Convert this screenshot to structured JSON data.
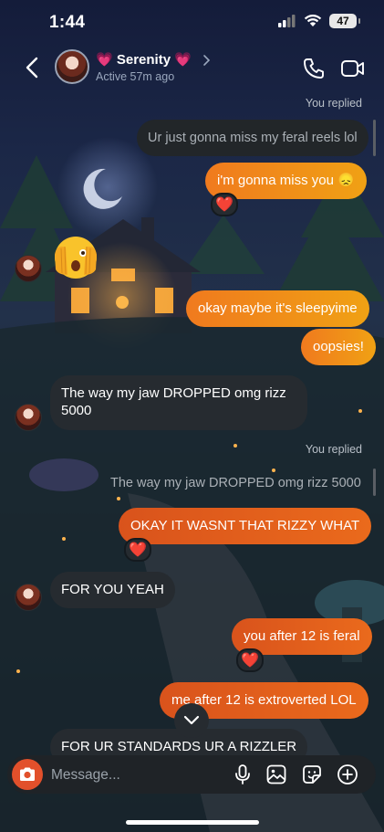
{
  "status_bar": {
    "time": "1:44",
    "battery": "47"
  },
  "header": {
    "contact_name": "💗 Serenity 💗",
    "status": "Active 57m ago",
    "icons": [
      "back-arrow-icon",
      "chevron-right-icon",
      "phone-icon",
      "video-camera-icon"
    ]
  },
  "messages": [
    {
      "type": "reply_label",
      "text": "You replied"
    },
    {
      "type": "quoted",
      "text": "Ur just gonna miss my feral reels lol"
    },
    {
      "type": "outgoing",
      "text": "i'm gonna miss you 😞",
      "reaction": "❤️"
    },
    {
      "type": "incoming_emoji",
      "emoji": "🫣"
    },
    {
      "type": "outgoing",
      "text": "okay maybe it's sleepyime"
    },
    {
      "type": "outgoing",
      "text": "oopsies!"
    },
    {
      "type": "incoming",
      "text_line1": "The way my jaw DROPPED omg rizz",
      "text_line2": "5000"
    },
    {
      "type": "reply_label",
      "text": "You replied"
    },
    {
      "type": "quoted",
      "text": "The way my jaw DROPPED omg rizz 5000"
    },
    {
      "type": "outgoing",
      "text": "OKAY IT WASNT THAT RIZZY WHAT",
      "reaction": "❤️"
    },
    {
      "type": "incoming",
      "text": "FOR YOU YEAH"
    },
    {
      "type": "outgoing",
      "text": "you after 12 is feral",
      "reaction": "❤️"
    },
    {
      "type": "outgoing",
      "text": "me after 12 is extroverted LOL"
    },
    {
      "type": "incoming",
      "text": "FOR UR STANDARDS UR A RIZZLER"
    }
  ],
  "composer": {
    "placeholder": "Message...",
    "icons": [
      "camera-icon",
      "microphone-icon",
      "gallery-icon",
      "sticker-icon",
      "plus-circle-icon"
    ]
  },
  "colors": {
    "outgoing_start": "#f07a1e",
    "outgoing_end": "#f0a114",
    "incoming": "#262b30",
    "camera": "#e2502b"
  }
}
